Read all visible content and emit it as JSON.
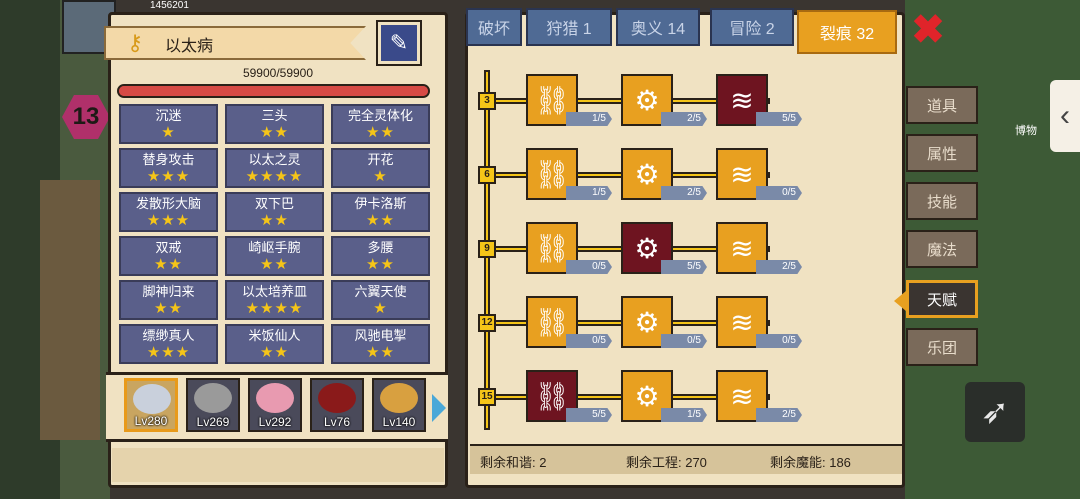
{
  "header": {
    "player_id": "1456201"
  },
  "badge_level": "13",
  "hero": {
    "title_icon": "key-icon",
    "name": "以太病",
    "hp_text": "59900/59900",
    "hp_fraction": 1.0,
    "hp_color": "#d64a45"
  },
  "traits": [
    {
      "name": "沉迷",
      "stars": "★"
    },
    {
      "name": "三头",
      "stars": "★★"
    },
    {
      "name": "完全灵体化",
      "stars": "★★"
    },
    {
      "name": "替身攻击",
      "stars": "★★★"
    },
    {
      "name": "以太之灵",
      "stars": "★★★★"
    },
    {
      "name": "开花",
      "stars": "★"
    },
    {
      "name": "发散形大脑",
      "stars": "★★★"
    },
    {
      "name": "双下巴",
      "stars": "★★"
    },
    {
      "name": "伊卡洛斯",
      "stars": "★★"
    },
    {
      "name": "双戒",
      "stars": "★★"
    },
    {
      "name": "崎岖手腕",
      "stars": "★★"
    },
    {
      "name": "多腰",
      "stars": "★★"
    },
    {
      "name": "脚神归来",
      "stars": "★★"
    },
    {
      "name": "以太培养皿",
      "stars": "★★★★"
    },
    {
      "name": "六翼天使",
      "stars": "★"
    },
    {
      "name": "缥缈真人",
      "stars": "★★★"
    },
    {
      "name": "米饭仙人",
      "stars": "★★"
    },
    {
      "name": "风驰电掣",
      "stars": "★★"
    }
  ],
  "party": [
    {
      "level": "Lv280",
      "color": "#c9d0dc"
    },
    {
      "level": "Lv269",
      "color": "#9a9a9a"
    },
    {
      "level": "Lv292",
      "color": "#e89ab0"
    },
    {
      "level": "Lv76",
      "color": "#8a1a1a"
    },
    {
      "level": "Lv140",
      "color": "#d8a040"
    }
  ],
  "tabs": [
    {
      "label": "破坏"
    },
    {
      "label": "狩猎 1"
    },
    {
      "label": "奥义 14"
    },
    {
      "label": "冒险 2"
    },
    {
      "label": "裂痕 32"
    }
  ],
  "talent_rows": [
    {
      "level": "3",
      "nodes": [
        {
          "icon": "link-icon",
          "count": "1/5",
          "maxed": false
        },
        {
          "icon": "gear-icon",
          "count": "2/5",
          "maxed": false
        },
        {
          "icon": "claw-icon",
          "count": "5/5",
          "maxed": true
        }
      ]
    },
    {
      "level": "6",
      "nodes": [
        {
          "icon": "link-icon",
          "count": "1/5",
          "maxed": false
        },
        {
          "icon": "gear-icon",
          "count": "2/5",
          "maxed": false
        },
        {
          "icon": "claw-icon",
          "count": "0/5",
          "maxed": false
        }
      ]
    },
    {
      "level": "9",
      "nodes": [
        {
          "icon": "link-icon",
          "count": "0/5",
          "maxed": false
        },
        {
          "icon": "gear-icon",
          "count": "5/5",
          "maxed": true
        },
        {
          "icon": "claw-icon",
          "count": "2/5",
          "maxed": false
        }
      ]
    },
    {
      "level": "12",
      "nodes": [
        {
          "icon": "link-icon",
          "count": "0/5",
          "maxed": false
        },
        {
          "icon": "gear-icon",
          "count": "0/5",
          "maxed": false
        },
        {
          "icon": "claw-icon",
          "count": "0/5",
          "maxed": false
        }
      ]
    },
    {
      "level": "15",
      "nodes": [
        {
          "icon": "link-icon",
          "count": "5/5",
          "maxed": true
        },
        {
          "icon": "gear-icon",
          "count": "1/5",
          "maxed": false
        },
        {
          "icon": "claw-icon",
          "count": "2/5",
          "maxed": false
        }
      ]
    }
  ],
  "footer": {
    "harmony": "剩余和谐: 2",
    "engineering": "剩余工程: 270",
    "magic": "剩余魔能: 186"
  },
  "side_menu": [
    {
      "label": "道具"
    },
    {
      "label": "属性"
    },
    {
      "label": "技能"
    },
    {
      "label": "魔法"
    },
    {
      "label": "天赋"
    },
    {
      "label": "乐团"
    }
  ],
  "museum_label": "博物"
}
